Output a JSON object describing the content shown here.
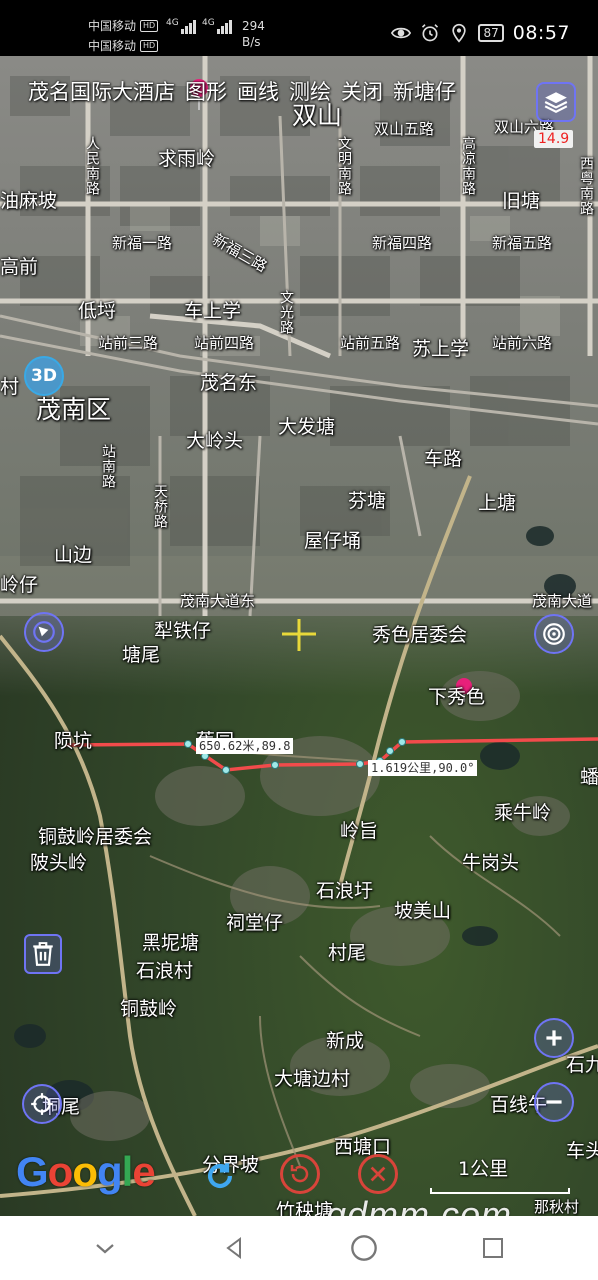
{
  "status_bar": {
    "carrier_1": "中国移动",
    "carrier_2": "中国移动",
    "hd_1": "HD",
    "hd_2": "HD",
    "net_1": "4G",
    "net_2": "4G",
    "net_speed_value": "294",
    "net_speed_unit": "B/s",
    "battery": "87",
    "time": "08:57"
  },
  "top_menu": {
    "hotel_label": "茂名国际大酒店",
    "items": [
      "图形",
      "画线",
      "测绘",
      "关闭"
    ],
    "extra_label": "新塘仔"
  },
  "zoom_level": "14.9",
  "btn_3d_label": "3D",
  "measurements": {
    "segment_label": "650.62米,89.8",
    "total_label": "1.619公里,90.0°"
  },
  "places": [
    "双山",
    "双山五路",
    "双山六路",
    "求雨岭",
    "人民南路",
    "文明南路",
    "高凉南路",
    "油麻坡",
    "旧塘",
    "新福一路",
    "新福三路",
    "新福四路",
    "新福五路",
    "西粤南路",
    "高前",
    "低埒",
    "车上学",
    "文光路",
    "站前三路",
    "站前四路",
    "站前五路",
    "苏上学",
    "站前六路",
    "茂名东",
    "茂南区",
    "村",
    "大发塘",
    "大岭头",
    "车路",
    "站南路",
    "天桥路",
    "芬塘",
    "上塘",
    "屋仔埇",
    "山边",
    "岭仔",
    "茂南大道东",
    "茂南大道",
    "犁铁仔",
    "秀色居委会",
    "塘尾",
    "下秀色",
    "陨坑",
    "蕉园",
    "乘牛岭",
    "蟠",
    "铜鼓岭居委会",
    "岭旨",
    "陂头岭",
    "牛岗头",
    "石浪圩",
    "坡美山",
    "祠堂仔",
    "黑坭塘",
    "村尾",
    "石浪村",
    "铜鼓岭",
    "新成",
    "石九",
    "大塘边村",
    "垌尾",
    "百线午",
    "车头",
    "西塘口",
    "分界坡",
    "竹秧塘",
    "那秋村"
  ],
  "google_logo": [
    "G",
    "o",
    "o",
    "g",
    "l",
    "e"
  ],
  "scale_label": "1公里",
  "watermark": "gdmm.com",
  "colors": {
    "accent": "#6f74f4",
    "measure_line": "#f24b4b",
    "pin": "#e8207a",
    "zoom_text": "#e22222",
    "bottom_ctl": "#d8443a"
  }
}
